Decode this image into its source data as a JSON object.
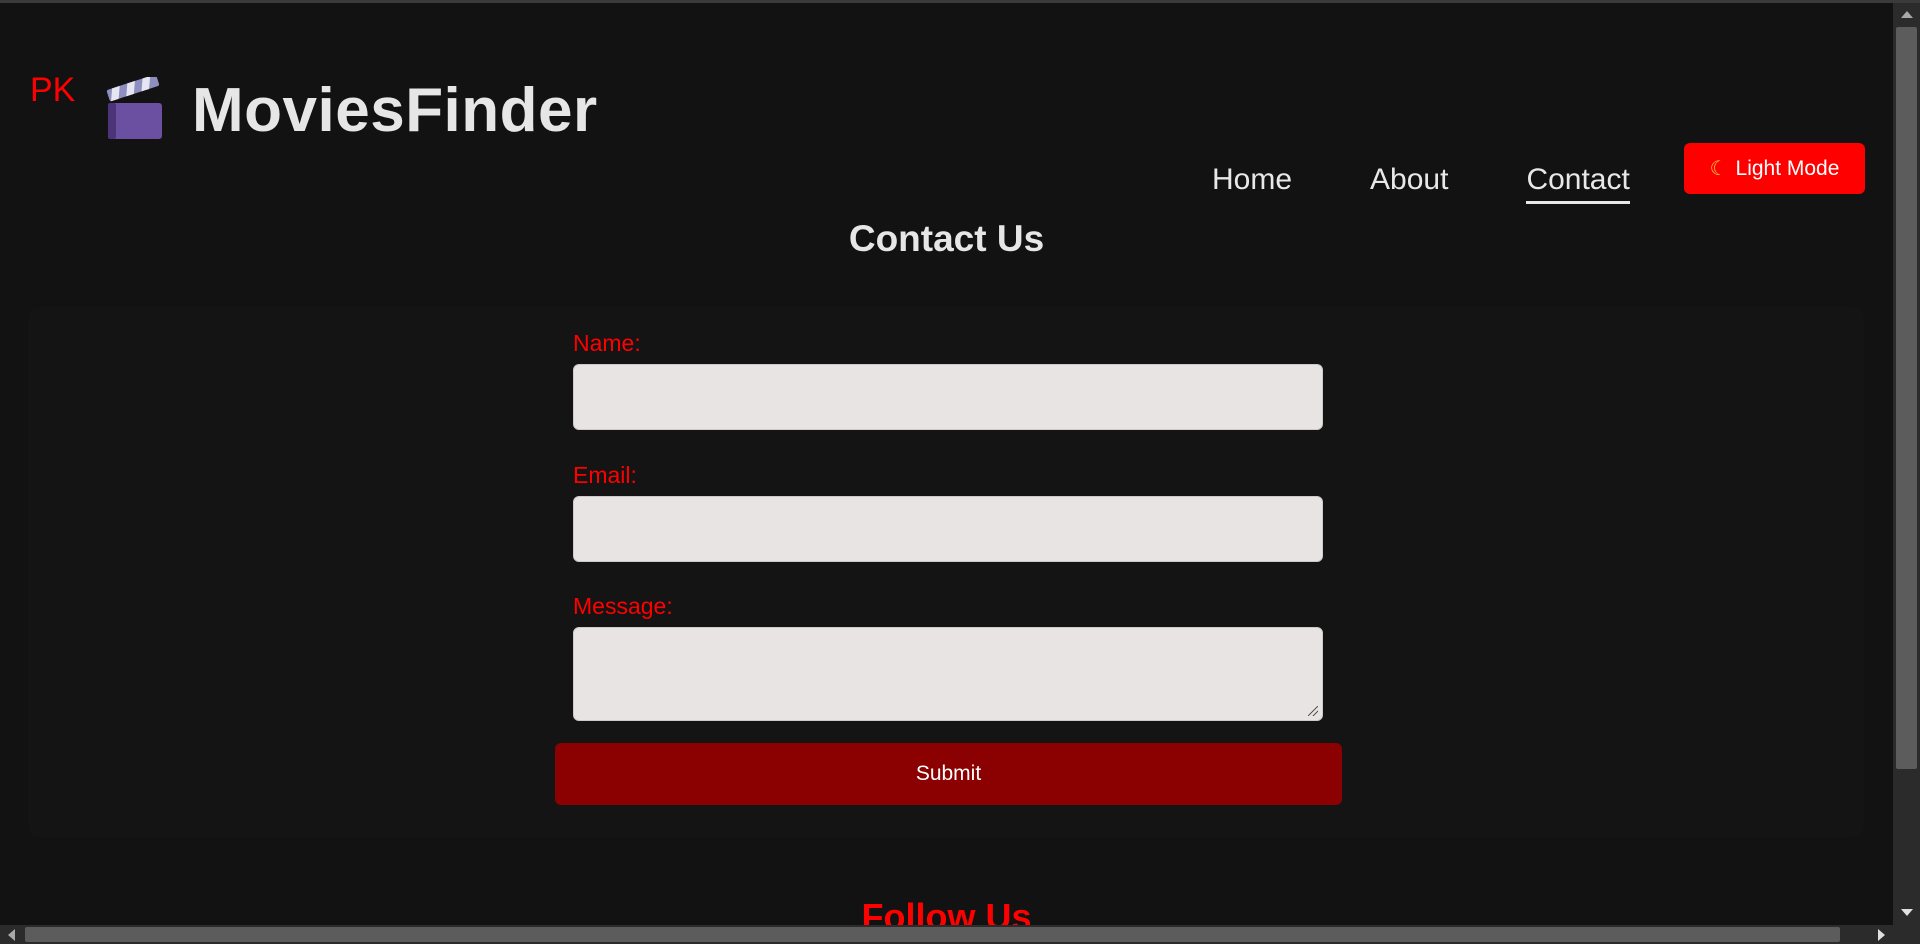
{
  "header": {
    "badge": "PK",
    "logo_icon": "clapperboard-icon",
    "brand": "MoviesFinder"
  },
  "nav": {
    "items": [
      {
        "label": "Home",
        "active": false
      },
      {
        "label": "About",
        "active": false
      },
      {
        "label": "Contact",
        "active": true
      }
    ]
  },
  "theme_toggle": {
    "icon": "moon-icon",
    "label": "Light Mode"
  },
  "contact": {
    "title": "Contact Us",
    "name_label": "Name:",
    "name_value": "",
    "email_label": "Email:",
    "email_value": "",
    "message_label": "Message:",
    "message_value": "",
    "submit_label": "Submit"
  },
  "follow": {
    "title": "Follow Us"
  },
  "colors": {
    "background": "#121212",
    "accent": "#ff0000",
    "submit": "#8b0000",
    "text": "#e6e6e6",
    "input": "#e8e4e4"
  }
}
